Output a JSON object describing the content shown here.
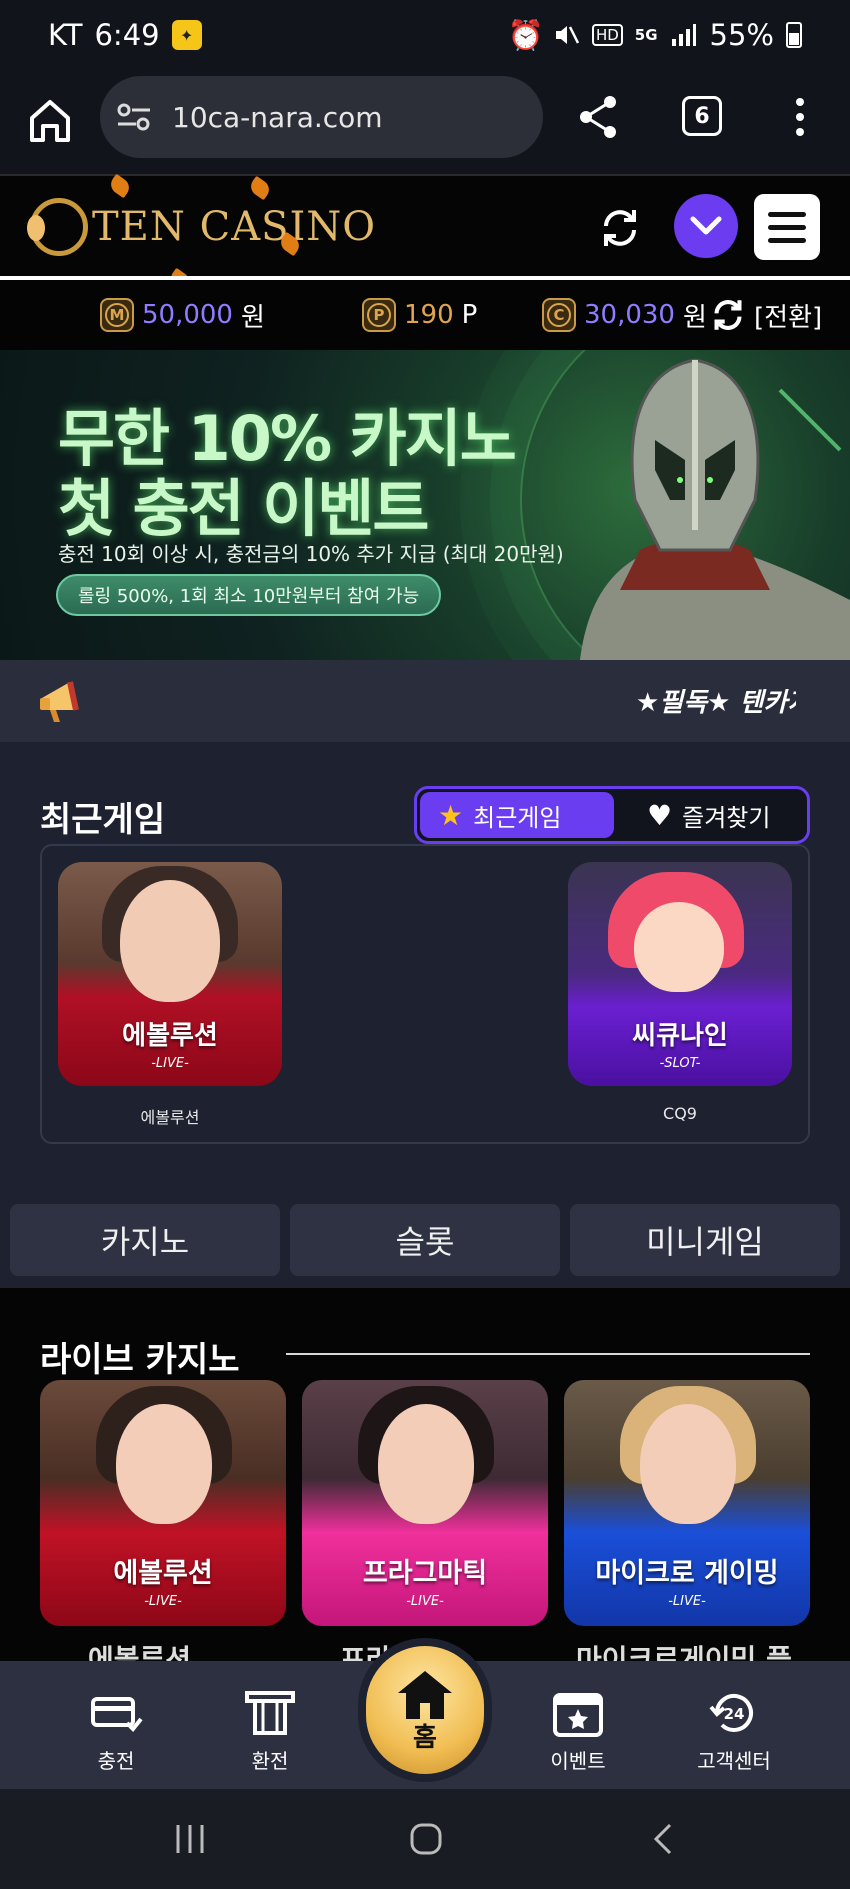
{
  "status_bar": {
    "carrier": "KT",
    "time": "6:49",
    "network_badge": "5G",
    "hd_badge": "HD",
    "battery": "55%"
  },
  "browser": {
    "url": "10ca-nara.com",
    "tab_count": "6"
  },
  "header": {
    "logo_text": "TEN CASINO",
    "brand_color": "#6b3cf0"
  },
  "balance": {
    "money_icon": "M",
    "money_value": "50,000",
    "money_unit": "원",
    "point_icon": "P",
    "point_value": "190",
    "point_unit": "P",
    "coin_icon": "C",
    "coin_value": "30,030",
    "coin_unit": "원",
    "swap_label": "[전환]"
  },
  "banner": {
    "title_line1": "무한 10% 카지노",
    "title_line2": "첫 충전 이벤트",
    "description": "충전 10회 이상 시, 충전금의 10% 추가 지급 (최대 20만원)",
    "pill": "롤링 500%, 1회 최소 10만원부터 참여 가능"
  },
  "notice": {
    "ticker": "★필독★ 텐카지노"
  },
  "recent": {
    "title": "최근게임",
    "tab_recent": "최근게임",
    "tab_favorites": "즐겨찾기",
    "games": [
      {
        "card_name": "에볼루션",
        "card_sub": "-LIVE-",
        "label": "에볼루션"
      },
      {
        "card_name": "씨큐나인",
        "card_sub": "-SLOT-",
        "label": "CQ9"
      }
    ]
  },
  "categories": [
    "카지노",
    "슬롯",
    "미니게임"
  ],
  "live_casino": {
    "title": "라이브 카지노",
    "cards": [
      {
        "name": "에볼루션",
        "sub": "-LIVE-",
        "label": "에볼루션"
      },
      {
        "name": "프라그마틱",
        "sub": "-LIVE-",
        "label": "프라그마틱"
      },
      {
        "name": "마이크로 게이밍",
        "sub": "-LIVE-",
        "label": "마이크로게이밍 플"
      }
    ]
  },
  "bottom_nav": {
    "deposit": "충전",
    "withdraw": "환전",
    "home": "홈",
    "event": "이벤트",
    "support": "고객센터",
    "support_icon_text": "24"
  }
}
